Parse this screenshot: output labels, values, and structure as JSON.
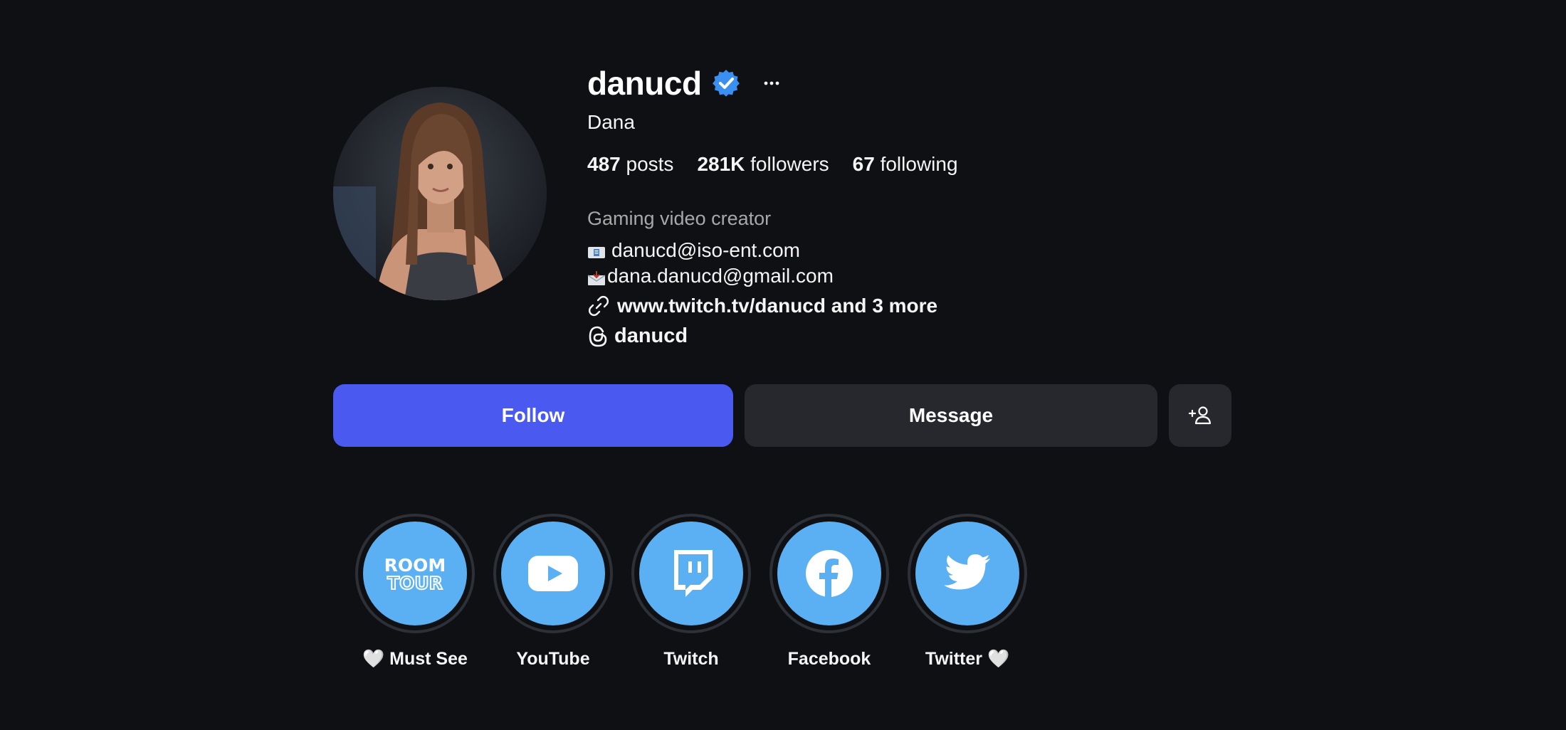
{
  "profile": {
    "username": "danucd",
    "display_name": "Dana",
    "stats": {
      "posts_count": "487",
      "posts_label": "posts",
      "followers_count": "281K",
      "followers_label": "followers",
      "following_count": "67",
      "following_label": "following"
    },
    "category": "Gaming video creator",
    "bio_lines": [
      {
        "emoji": "envelope-icon",
        "text": "danucd@iso-ent.com"
      },
      {
        "emoji": "inbox-icon",
        "text": "dana.danucd@gmail.com"
      }
    ],
    "link": "www.twitch.tv/danucd and 3 more",
    "threads_handle": "danucd"
  },
  "actions": {
    "follow_label": "Follow",
    "message_label": "Message"
  },
  "highlights": [
    {
      "label": "🤍 Must See",
      "icon": "room-tour-icon",
      "art_line1": "ROOM",
      "art_line2": "TOUR"
    },
    {
      "label": "YouTube",
      "icon": "youtube-icon"
    },
    {
      "label": "Twitch",
      "icon": "twitch-icon"
    },
    {
      "label": "Facebook",
      "icon": "facebook-icon"
    },
    {
      "label": "Twitter 🤍",
      "icon": "twitter-icon"
    }
  ],
  "colors": {
    "background": "#0f1014",
    "follow_button": "#4a5af0",
    "secondary_button": "#26282d",
    "verified_badge": "#3b8ff0",
    "highlight_fill": "#5ab0f2",
    "muted_text": "#a8a8a8"
  }
}
